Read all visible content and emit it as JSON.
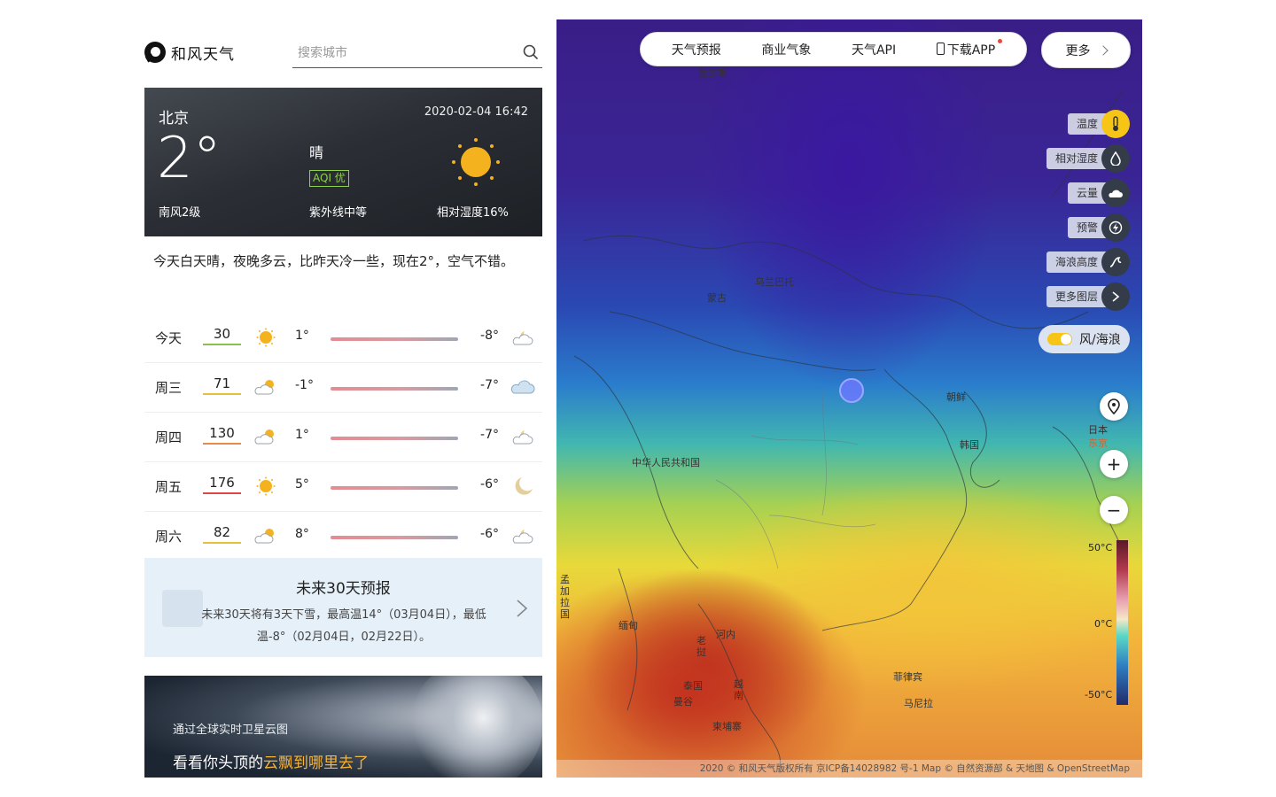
{
  "brand": {
    "name": "和风天气"
  },
  "search": {
    "placeholder": "搜索城市"
  },
  "now": {
    "city": "北京",
    "datetime": "2020-02-04 16:42",
    "temp": "2°",
    "condition": "晴",
    "aqi": "AQI 优",
    "wind": "南风2级",
    "uv": "紫外线中等",
    "humidity": "相对湿度16%"
  },
  "summary": "今天白天晴，夜晚多云，比昨天冷一些，现在2°，空气不错。",
  "forecast": [
    {
      "day": "今天",
      "aqi": "30",
      "aqi_color": "#8cc04b",
      "high": "1°",
      "low": "-8°",
      "day_icon": "sun-icon",
      "night_icon": "partly-cloudy-night-icon"
    },
    {
      "day": "周三",
      "aqi": "71",
      "aqi_color": "#e5c13a",
      "high": "-1°",
      "low": "-7°",
      "day_icon": "partly-cloudy-icon",
      "night_icon": "cloud-icon"
    },
    {
      "day": "周四",
      "aqi": "130",
      "aqi_color": "#e88b4a",
      "high": "1°",
      "low": "-7°",
      "day_icon": "partly-cloudy-icon",
      "night_icon": "partly-cloudy-night-icon"
    },
    {
      "day": "周五",
      "aqi": "176",
      "aqi_color": "#e04848",
      "high": "5°",
      "low": "-6°",
      "day_icon": "sun-icon",
      "night_icon": "moon-icon"
    },
    {
      "day": "周六",
      "aqi": "82",
      "aqi_color": "#e5c13a",
      "high": "8°",
      "low": "-6°",
      "day_icon": "partly-cloudy-icon",
      "night_icon": "partly-cloudy-night-icon"
    }
  ],
  "forecast30": {
    "title": "未来30天预报",
    "desc": "未来30天将有3天下雪，最高温14°（03月04日），最低温-8°（02月04日，02月22日）。"
  },
  "satellite": {
    "sub": "通过全球实时卫星云图",
    "main_prefix": "看看你头顶的",
    "main_highlight": "云飘到哪里去了"
  },
  "map": {
    "nav": [
      "天气预报",
      "商业气象",
      "天气API",
      "下载APP"
    ],
    "more": "更多",
    "layers": [
      {
        "label": "温度",
        "icon": "thermometer-icon",
        "active": true
      },
      {
        "label": "相对湿度",
        "icon": "droplet-icon",
        "active": false
      },
      {
        "label": "云量",
        "icon": "cloud-icon",
        "active": false
      },
      {
        "label": "预警",
        "icon": "warning-icon",
        "active": false
      },
      {
        "label": "海浪高度",
        "icon": "wave-icon",
        "active": false
      },
      {
        "label": "更多图层",
        "icon": "chevron-right-icon",
        "active": false
      }
    ],
    "wind_toggle": "风/海浪",
    "zoom_in": "+",
    "zoom_out": "−",
    "legend": {
      "max": "50°C",
      "mid": "0°C",
      "min": "-50°C"
    },
    "labels": {
      "russia": "俄罗斯",
      "mongolia": "蒙古",
      "ulaanbaatar": "乌兰巴托",
      "china": "中华人民共和国",
      "nkorea": "朝鲜",
      "skorea": "韩国",
      "japan": "日本",
      "tokyo": "东京",
      "philippines": "菲律宾",
      "manila": "马尼拉",
      "thailand": "泰国",
      "bangkok": "曼谷",
      "myanmar": "缅甸",
      "cambodia": "柬埔寨",
      "laos": "老挝",
      "vietnam": "越南",
      "bangladesh": "孟加拉国",
      "hanoi": "河内"
    },
    "attribution": "2020 © 和风天气版权所有 京ICP备14028982 号-1 Map © 自然资源部 & 天地图 & OpenStreetMap"
  }
}
